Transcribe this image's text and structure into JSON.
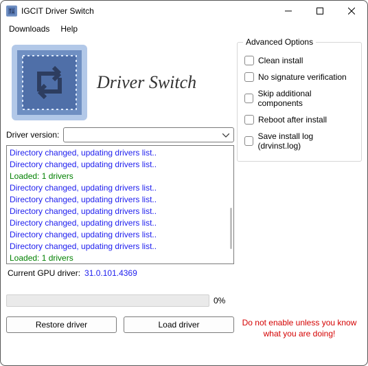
{
  "window": {
    "title": "IGCIT Driver Switch"
  },
  "menu": {
    "downloads": "Downloads",
    "help": "Help"
  },
  "header": {
    "heading": "Driver Switch"
  },
  "driver": {
    "label": "Driver version:",
    "selected": ""
  },
  "log": {
    "entries": [
      {
        "text": "Directory changed, updating drivers list..",
        "cls": "log-blue"
      },
      {
        "text": "Directory changed, updating drivers list..",
        "cls": "log-blue"
      },
      {
        "text": "Loaded: 1 drivers",
        "cls": "log-green"
      },
      {
        "text": "Directory changed, updating drivers list..",
        "cls": "log-blue"
      },
      {
        "text": "Directory changed, updating drivers list..",
        "cls": "log-blue"
      },
      {
        "text": "Directory changed, updating drivers list..",
        "cls": "log-blue"
      },
      {
        "text": "Directory changed, updating drivers list..",
        "cls": "log-blue"
      },
      {
        "text": "Directory changed, updating drivers list..",
        "cls": "log-blue"
      },
      {
        "text": "Directory changed, updating drivers list..",
        "cls": "log-blue"
      },
      {
        "text": "Loaded: 1 drivers",
        "cls": "log-green"
      }
    ]
  },
  "current": {
    "label": "Current GPU driver:",
    "value": "31.0.101.4369"
  },
  "progress": {
    "percent": "0%"
  },
  "buttons": {
    "restore": "Restore driver",
    "load": "Load driver"
  },
  "advanced": {
    "group_title": "Advanced Options",
    "options": [
      "Clean install",
      "No signature verification",
      "Skip additional components",
      "Reboot after install",
      "Save install log (drvinst.log)"
    ],
    "warning_l1": "Do not enable unless you know",
    "warning_l2": "what you are doing!"
  },
  "colors": {
    "accent": "#6f8fc2",
    "log_info": "#2020ee",
    "log_ok": "#008000",
    "warning": "#d40000"
  }
}
